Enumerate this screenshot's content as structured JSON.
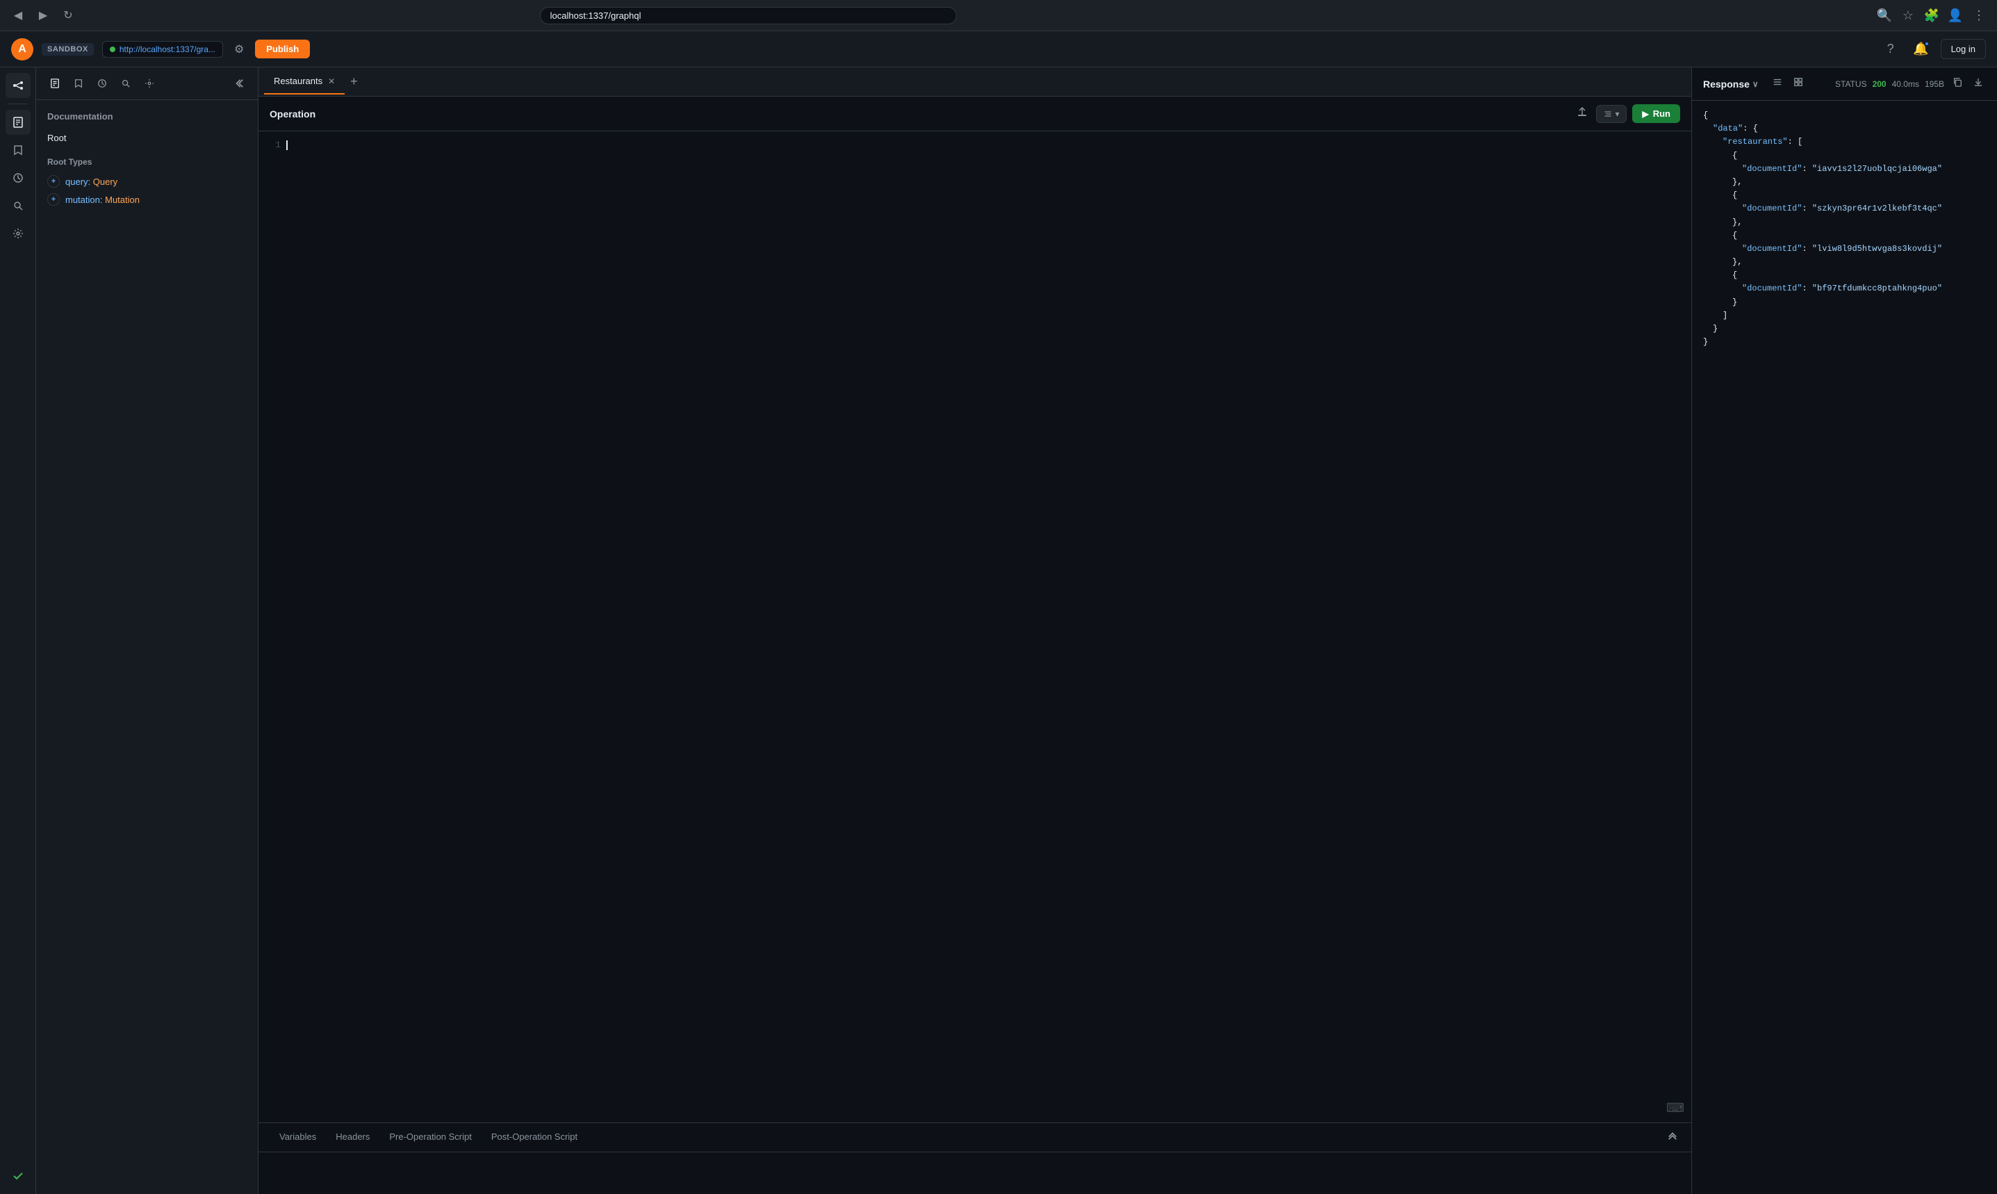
{
  "browser": {
    "url": "localhost:1337/graphql",
    "back_btn": "◀",
    "forward_btn": "▶",
    "reload_btn": "↻"
  },
  "appbar": {
    "logo": "A",
    "sandbox_label": "SANDBOX",
    "env_url": "http://localhost:1337/gra...",
    "publish_label": "Publish",
    "login_label": "Log in"
  },
  "sidebar": {
    "documentation_title": "Documentation",
    "root_label": "Root",
    "root_types_title": "Root Types",
    "query_keyword": "query:",
    "query_type": "Query",
    "mutation_keyword": "mutation:",
    "mutation_type": "Mutation",
    "tools": {
      "docs": "📄",
      "bookmark": "🔖",
      "history": "🕐",
      "search": "🔍",
      "settings": "⚙"
    }
  },
  "editor": {
    "tab_name": "Restaurants",
    "operation_title": "Operation",
    "line_numbers": [
      "1"
    ],
    "run_label": "Run",
    "bottom_tabs": [
      {
        "label": "Variables",
        "active": false
      },
      {
        "label": "Headers",
        "active": false
      },
      {
        "label": "Pre-Operation Script",
        "active": false
      },
      {
        "label": "Post-Operation Script",
        "active": false
      }
    ]
  },
  "response": {
    "title": "Response",
    "status_label": "STATUS",
    "status_code": "200",
    "response_time": "40.0ms",
    "response_size": "195B",
    "json_content": {
      "data": {
        "restaurants": [
          {
            "documentId": "iavv1s2l27uoblqcjai06wga"
          },
          {
            "documentId": "szkyn3pr64r1v2lkebf3t4qc"
          },
          {
            "documentId": "lviw8l9d5htwvga8s3kovdij"
          },
          {
            "documentId": "bf97tfdumkcc8ptahkng4puo"
          }
        ]
      }
    }
  },
  "icons": {
    "check": "✓",
    "collapse": "«",
    "chevron_down": "∨",
    "plus": "+",
    "upload": "↑",
    "copy": "⧉",
    "download": "↓",
    "list": "≡",
    "grid": "⊞",
    "keyboard": "⌨",
    "collapse_up": "⌃⌃"
  }
}
